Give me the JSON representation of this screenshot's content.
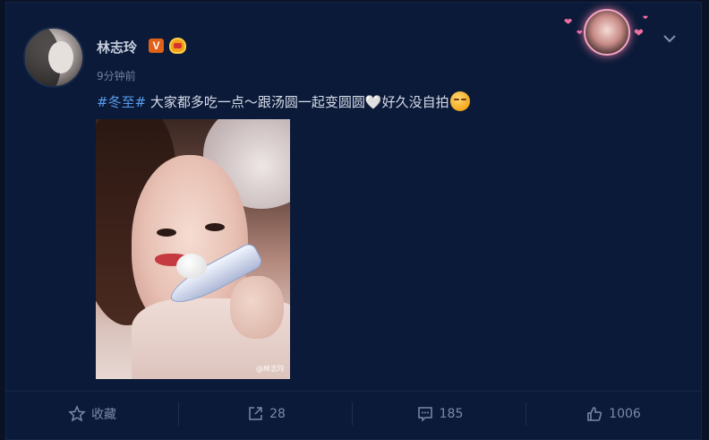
{
  "post": {
    "author": "林志玲",
    "verified_badge": "V",
    "time": "9分钟前",
    "hashtag": "#冬至#",
    "text": " 大家都多吃一点～跟汤圆一起变圆圆🤍好久没自拍",
    "image_watermark": "@林志玲"
  },
  "actions": {
    "favorite_label": "收藏",
    "repost_count": "28",
    "comment_count": "185",
    "like_count": "1006"
  },
  "colors": {
    "background": "#0a1226",
    "card": "#0b1a38",
    "hashtag": "#5a9cf0",
    "muted": "#7b8aa8"
  },
  "icons": [
    "chevron-down-icon",
    "star-icon",
    "share-icon",
    "comment-icon",
    "like-icon",
    "vip-crown-icon"
  ]
}
